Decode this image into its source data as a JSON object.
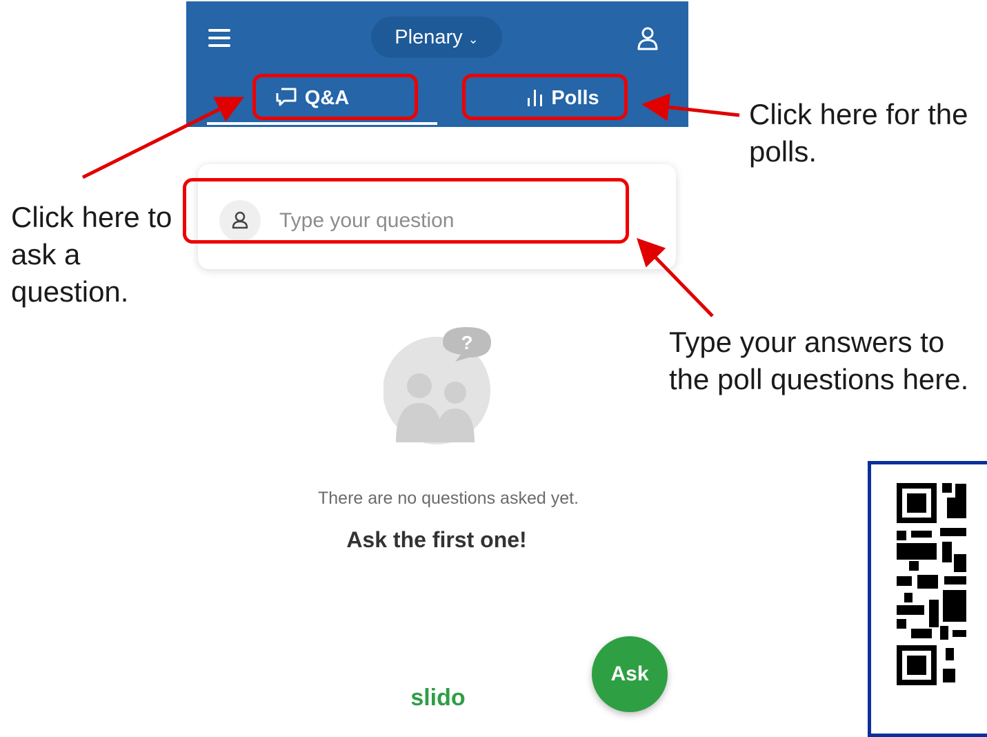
{
  "header": {
    "event_name": "Plenary",
    "tabs": [
      {
        "label": "Q&A",
        "active": true
      },
      {
        "label": "Polls",
        "active": false
      }
    ]
  },
  "question_box": {
    "placeholder": "Type your question"
  },
  "empty_state": {
    "message": "There are no questions asked yet.",
    "cta": "Ask the first one!"
  },
  "ask_button": {
    "label": "Ask"
  },
  "logo": {
    "text": "slido"
  },
  "annotations": {
    "polls_note": "Click here for the polls.",
    "ask_note": "Click here to ask a question.",
    "answers_note": "Type your answers to the poll questions here."
  },
  "colors": {
    "header_bg": "#2565a8",
    "ask_button": "#2ea043",
    "logo": "#2f9e46",
    "highlight": "#ee0000",
    "qr_border": "#0b2f9c"
  }
}
